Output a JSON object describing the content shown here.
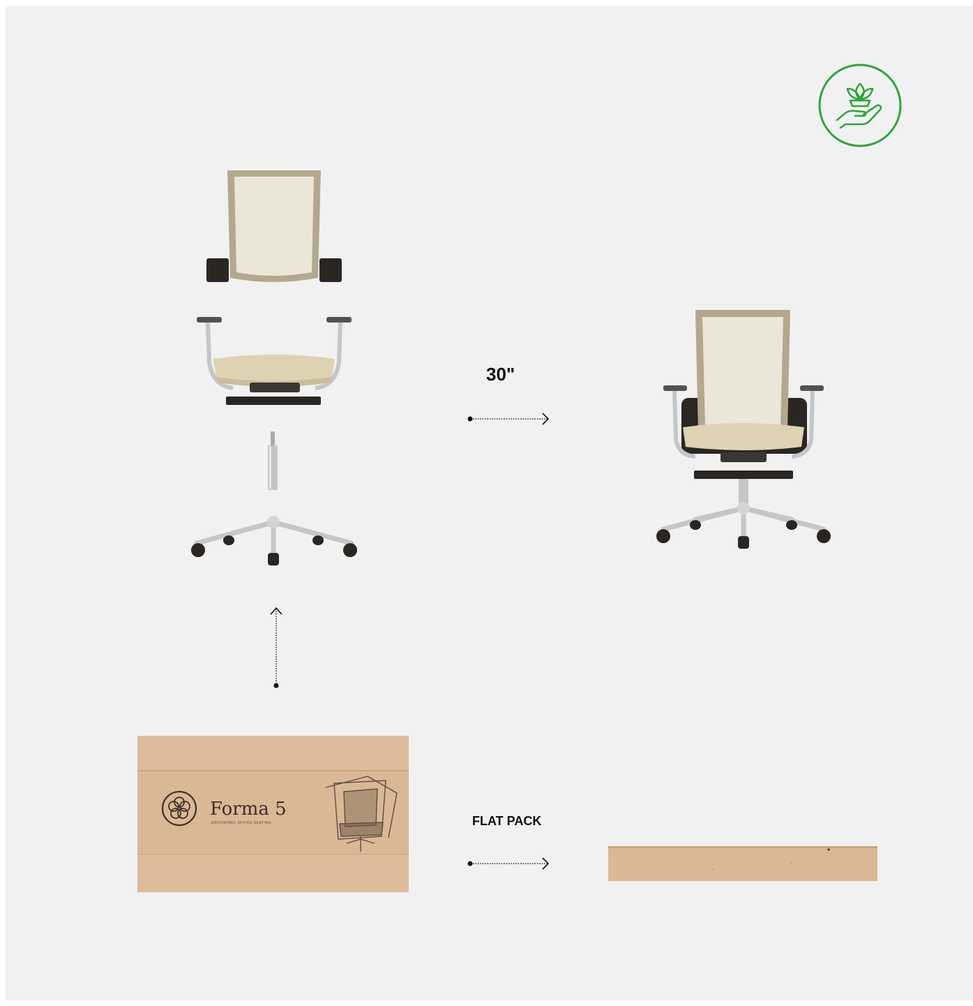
{
  "colors": {
    "panel_background": "#f1f1f1",
    "accent_green": "#2fa53a",
    "mesh": "#ece6d8",
    "frame": "#b3a88e",
    "seat": "#ddd3b3",
    "cardboard": "#d9b896",
    "metal": "#c4c6c8",
    "dark": "#2a2622"
  },
  "icons": {
    "eco_badge": "hand-holding-plant-icon",
    "horizontal_arrow": "dotted-arrow-right-icon",
    "vertical_arrow": "dotted-arrow-up-icon"
  },
  "labels": {
    "assembly_time": "30\"",
    "flat_pack": "FLAT PACK"
  },
  "box": {
    "brand_name": "Forma 5",
    "brand_tagline": "ERGONOMIC OFFICE SEATING"
  }
}
